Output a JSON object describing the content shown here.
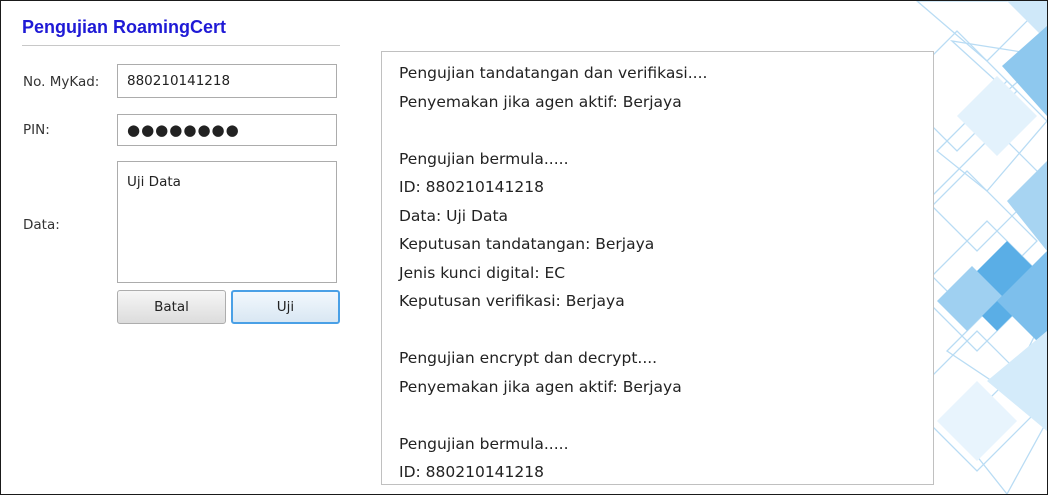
{
  "form": {
    "title": "Pengujian RoamingCert",
    "mykad_label": "No. MyKad:",
    "mykad_value": "880210141218",
    "pin_label": "PIN:",
    "pin_value": "●●●●●●●●",
    "data_label": "Data:",
    "data_value": "Uji Data",
    "cancel_label": "Batal",
    "test_label": "Uji"
  },
  "log": {
    "text": "Pengujian tandatangan dan verifikasi....\nPenyemakan jika agen aktif: Berjaya\n\nPengujian bermula.....\nID: 880210141218\nData: Uji Data\nKeputusan tandatangan: Berjaya\nJenis kunci digital: EC\nKeputusan verifikasi: Berjaya\n\nPengujian encrypt dan decrypt....\nPenyemakan jika agen aktif: Berjaya\n\nPengujian bermula.....\nID: 880210141218"
  },
  "colors": {
    "title": "#1f1ad6",
    "focus_border": "#4aa0e6",
    "decor_blue": "#5aaee6"
  }
}
